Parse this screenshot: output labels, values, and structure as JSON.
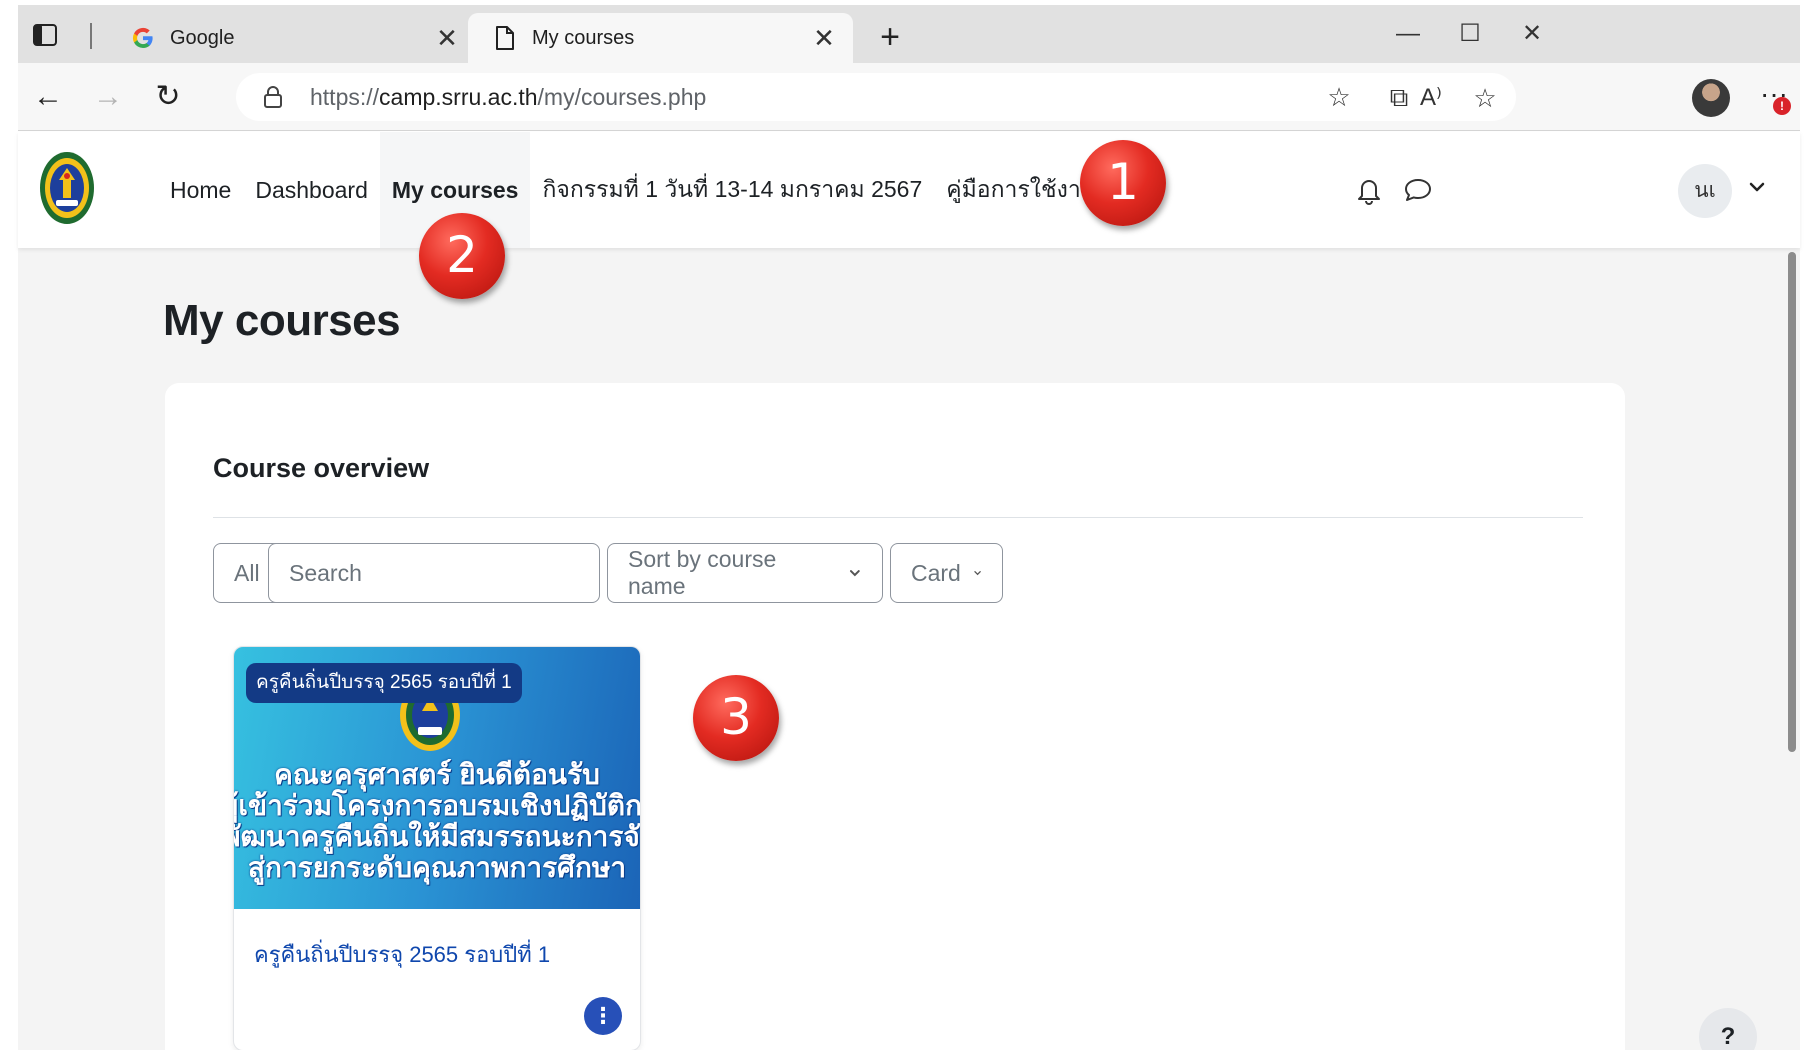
{
  "browser": {
    "tabs": [
      {
        "label": "Google",
        "icon": "google-icon"
      },
      {
        "label": "My courses",
        "icon": "page-icon"
      }
    ],
    "close_glyph": "✕",
    "new_tab_glyph": "+",
    "window_controls": {
      "minimize": "—",
      "maximize": "☐",
      "close": "✕"
    },
    "nav": {
      "back": "←",
      "forward": "→",
      "reload": "↻"
    },
    "url_protocol": "https://",
    "url_host": "camp.srru.ac.th",
    "url_path": "/my/courses.php",
    "address_actions": {
      "read_aloud": "A⁾",
      "favorite": "☆"
    },
    "toolbar": {
      "favorites": "☆",
      "collections": "⧉",
      "more": "···",
      "notification_badge": "!"
    }
  },
  "navbar": {
    "links": [
      {
        "label": "Home",
        "active": false
      },
      {
        "label": "Dashboard",
        "active": false
      },
      {
        "label": "My courses",
        "active": true
      },
      {
        "label": "กิจกรรมที่ 1 วันที่ 13-14 มกราคม 2567",
        "active": false
      },
      {
        "label": "คู่มือการใช้งาน",
        "active": false
      }
    ],
    "user_initials": "นเ"
  },
  "callouts": [
    "1",
    "2",
    "3"
  ],
  "page": {
    "title": "My courses",
    "panel_heading": "Course overview",
    "filters": {
      "grouping": "All",
      "search_placeholder": "Search",
      "sort": "Sort by course name",
      "view": "Card"
    },
    "courses": [
      {
        "category_badge": "ครูคืนถิ่นปีบรรจุ 2565 รอบปีที่ 1",
        "image_text": [
          "คณะครุศาสตร์ ยินดีต้อนรับ",
          "ผู้เข้าร่วมโครงการอบรมเชิงปฏิบัติการ",
          "พัฒนาครูคืนถิ่นให้มีสมรรถนะการจัดการ",
          "สู่การยกระดับคุณภาพการศึกษา"
        ],
        "name": "ครูคืนถิ่นปีบรรจุ 2565 รอบปีที่ 1",
        "menu_glyph": "⋮"
      }
    ],
    "help_label": "?"
  },
  "colors": {
    "accent_link": "#0f47ad",
    "callout_red": "#e32b22",
    "page_bg": "#f4f4f4"
  }
}
